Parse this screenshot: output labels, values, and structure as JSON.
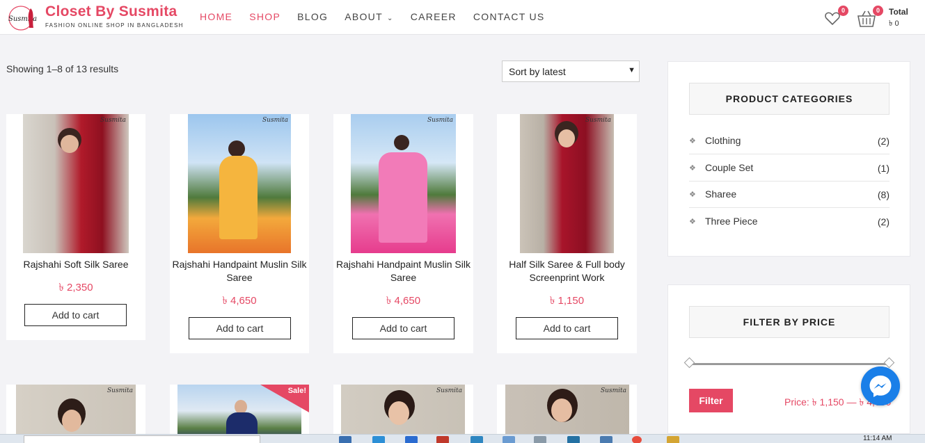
{
  "brand": {
    "title": "Closet By Susmita",
    "tagline": "FASHION ONLINE SHOP IN BANGLADESH",
    "logo_text": "Susmita",
    "accent": "#e54864"
  },
  "nav": {
    "items": [
      {
        "label": "HOME",
        "active": true
      },
      {
        "label": "SHOP",
        "active": true
      },
      {
        "label": "BLOG",
        "active": false
      },
      {
        "label": "ABOUT",
        "active": false,
        "dropdown": true
      },
      {
        "label": "CAREER",
        "active": false
      },
      {
        "label": "CONTACT US",
        "active": false
      }
    ]
  },
  "header_actions": {
    "wishlist_icon": "heart-icon",
    "wishlist_count": "0",
    "cart_icon": "basket-icon",
    "cart_count": "0",
    "total_label": "Total",
    "total_value": "৳ 0"
  },
  "shop": {
    "result_count": "Showing 1–8 of 13 results",
    "sort_selected": "Sort by latest",
    "products": [
      {
        "name": "Rajshahi Soft Silk Saree",
        "price": "৳ 2,350",
        "button": "Add to cart",
        "watermark": "Susmita",
        "sale": false
      },
      {
        "name": "Rajshahi Handpaint Muslin Silk Saree",
        "price": "৳ 4,650",
        "button": "Add to cart",
        "watermark": "Susmita",
        "sale": false
      },
      {
        "name": "Rajshahi Handpaint Muslin Silk Saree",
        "price": "৳ 4,650",
        "button": "Add to cart",
        "watermark": "Susmita",
        "sale": false
      },
      {
        "name": "Half Silk Saree & Full body Screenprint Work",
        "price": "৳ 1,150",
        "button": "Add to cart",
        "watermark": "Susmita",
        "sale": false
      },
      {
        "name": "",
        "price": "",
        "button": "",
        "watermark": "Susmita",
        "sale": false
      },
      {
        "name": "",
        "price": "",
        "button": "",
        "watermark": "",
        "sale": true,
        "sale_label": "Sale!"
      },
      {
        "name": "",
        "price": "",
        "button": "",
        "watermark": "Susmita",
        "sale": false
      },
      {
        "name": "",
        "price": "",
        "button": "",
        "watermark": "Susmita",
        "sale": false
      }
    ]
  },
  "sidebar": {
    "categories_title": "PRODUCT CATEGORIES",
    "categories": [
      {
        "name": "Clothing",
        "count": "(2)"
      },
      {
        "name": "Couple Set",
        "count": "(1)"
      },
      {
        "name": "Sharee",
        "count": "(8)"
      },
      {
        "name": "Three Piece",
        "count": "(2)"
      }
    ],
    "filter_title": "FILTER BY PRICE",
    "filter_button": "Filter",
    "price_range": "Price: ৳ 1,150 — ৳ 4,650"
  },
  "taskbar": {
    "time": "11:14 AM"
  }
}
